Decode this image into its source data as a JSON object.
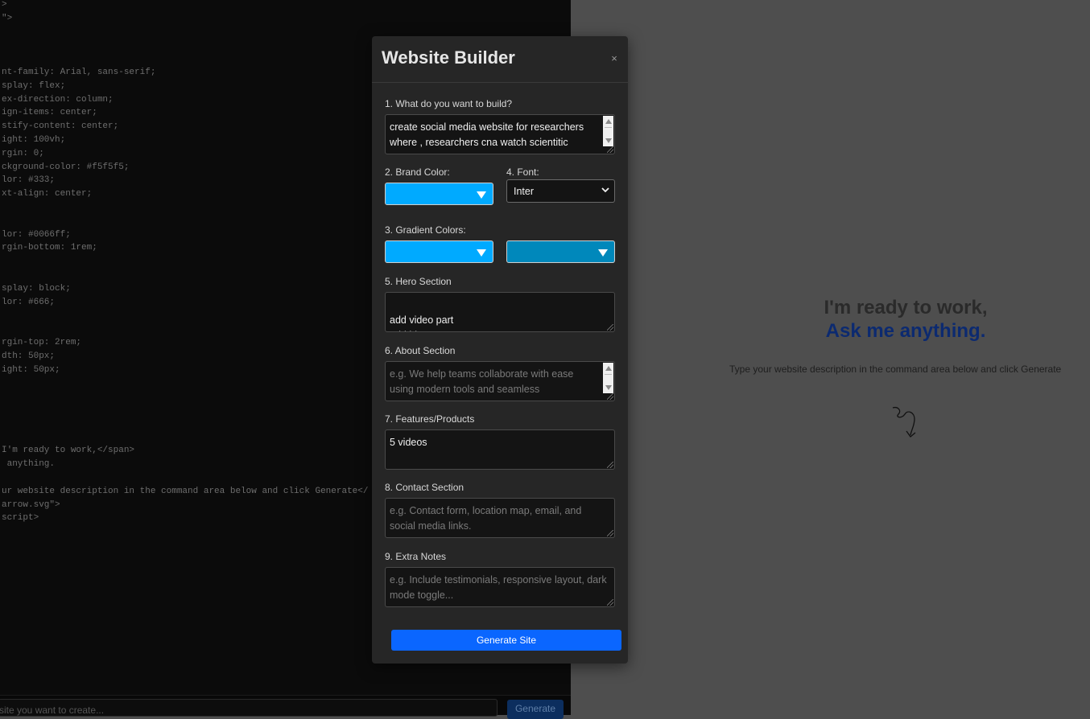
{
  "editor": {
    "code_lines": [
      ">",
      "\">",
      "nt-family: Arial, sans-serif;",
      "splay: flex;",
      "ex-direction: column;",
      "ign-items: center;",
      "stify-content: center;",
      "ight: 100vh;",
      "rgin: 0;",
      "ckground-color: #f5f5f5;",
      "lor: #333;",
      "xt-align: center;",
      "lor: #0066ff;",
      "rgin-bottom: 1rem;",
      "splay: block;",
      "lor: #666;",
      "rgin-top: 2rem;",
      "dth: 50px;",
      "ight: 50px;",
      "I'm ready to work,</span>",
      " anything.",
      "ur website description in the command area below and click Generate</",
      "arrow.svg\">",
      "script>"
    ],
    "command_placeholder": "site you want to create...",
    "generate_label": "Generate"
  },
  "preview": {
    "heading_line1": "I'm ready to work,",
    "heading_line2": "Ask me anything.",
    "hint": "Type your website description in the command area below and click Generate",
    "arrow_icon": "curly-arrow-icon"
  },
  "modal": {
    "title": "Website Builder",
    "close_label": "×",
    "build": {
      "label": "1. What do you want to build?",
      "value": "create social media website for researchers where , researchers cna watch scientitic"
    },
    "brand_color": {
      "label": "2. Brand Color:",
      "color": "#00aaff"
    },
    "font": {
      "label": "4. Font:",
      "value": "Inter"
    },
    "gradient": {
      "label": "3. Gradient Colors:",
      "color1": "#00aaff",
      "color2": "#0088bb"
    },
    "hero": {
      "label": "5. Hero Section",
      "value": "add video part\nadd blogs"
    },
    "about": {
      "label": "6. About Section",
      "placeholder": "e.g. We help teams collaborate with ease using modern tools and seamless"
    },
    "features": {
      "label": "7. Features/Products",
      "value": "5 videos"
    },
    "contact": {
      "label": "8. Contact Section",
      "placeholder": "e.g. Contact form, location map, email, and social media links."
    },
    "extra": {
      "label": "9. Extra Notes",
      "placeholder": "e.g. Include testimonials, responsive layout, dark mode toggle..."
    },
    "generate_label": "Generate Site"
  }
}
